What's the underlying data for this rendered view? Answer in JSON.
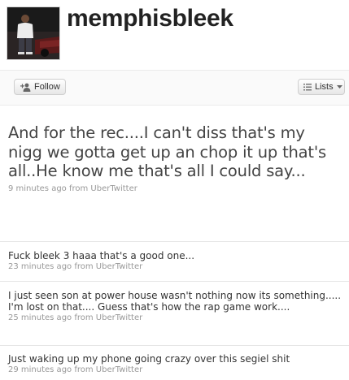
{
  "profile": {
    "username": "memphisbleek",
    "avatar_icon": "profile-photo"
  },
  "actions": {
    "follow_label": "Follow",
    "follow_icon": "add-user-icon",
    "lists_label": "Lists",
    "lists_icon": "list-icon",
    "lists_dropdown_icon": "caret-down-icon"
  },
  "featured_tweet": {
    "text": "And for the rec....I can't diss that's my nigg we gotta get up an chop it up that's all..He know me that's all I could say...",
    "meta": "9 minutes ago from UberTwitter"
  },
  "tweets": [
    {
      "text": "Fuck bleek 3 haaa that's a good one...",
      "meta": "23 minutes ago from UberTwitter"
    },
    {
      "text": "I just seen son at power house wasn't nothing now its something..... I'm lost on that.... Guess that's how the rap game work....",
      "meta": "25 minutes ago from UberTwitter"
    },
    {
      "text": "Just waking up my phone going crazy over this segiel shit",
      "meta": "29 minutes ago from UberTwitter"
    }
  ]
}
